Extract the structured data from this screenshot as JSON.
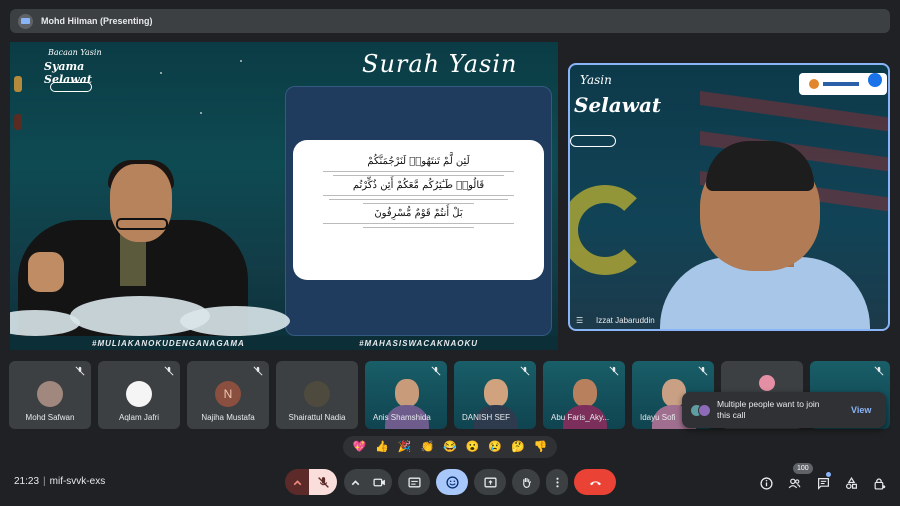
{
  "presenter": {
    "name": "Mohd Hilman (Presenting)"
  },
  "slide": {
    "event_line1": "Bacaan Yasin",
    "event_line2": "Syama Selawat",
    "title": "Surah Yasin",
    "hashtags": [
      "#MULIAKANOKUDENGANAGAMA",
      "#MAHASISWACAKNAOKU"
    ]
  },
  "camera": {
    "name": "Izzat Jabaruddin",
    "title1": "Yasin",
    "title2": "Selawat"
  },
  "participants": [
    {
      "name": "Mohd Safwan",
      "kind": "photo",
      "avatar_color": "#a1887f"
    },
    {
      "name": "Aqlam Jafri",
      "kind": "photo",
      "avatar_color": "#f5f5f5"
    },
    {
      "name": "Najiha Mustafa",
      "kind": "letter",
      "letter": "N"
    },
    {
      "name": "Shairattul Nadia",
      "kind": "photo",
      "avatar_color": "#4e4a3e"
    },
    {
      "name": "Anis Shamshida",
      "kind": "video",
      "face": "#c89b7b",
      "top": "#6d5c8c"
    },
    {
      "name": "DANISH SEF",
      "kind": "video",
      "face": "#d0a27e",
      "top": "#2e3b4e"
    },
    {
      "name": "Abu Faris_Aky...",
      "kind": "video",
      "face": "#b9805e",
      "top": "#7c2f5b"
    },
    {
      "name": "Idayu Sofi",
      "kind": "video",
      "face": "#c9a084",
      "top": "#a06f8f"
    }
  ],
  "toast": {
    "message": "Multiple people want to join this call",
    "action": "View",
    "avatar_colors": [
      "#5f9ea0",
      "#8e6bb8"
    ]
  },
  "reactions": [
    "💖",
    "👍",
    "🎉",
    "👏",
    "😂",
    "😮",
    "😢",
    "🤔",
    "👎"
  ],
  "meeting": {
    "time": "21:23",
    "code": "mif-svvk-exs"
  },
  "participant_count": "100",
  "colors": {
    "end_call": "#ea4335",
    "muted": "#f9dedc",
    "active": "#a8c7fa",
    "accent": "#8ab4f8"
  }
}
